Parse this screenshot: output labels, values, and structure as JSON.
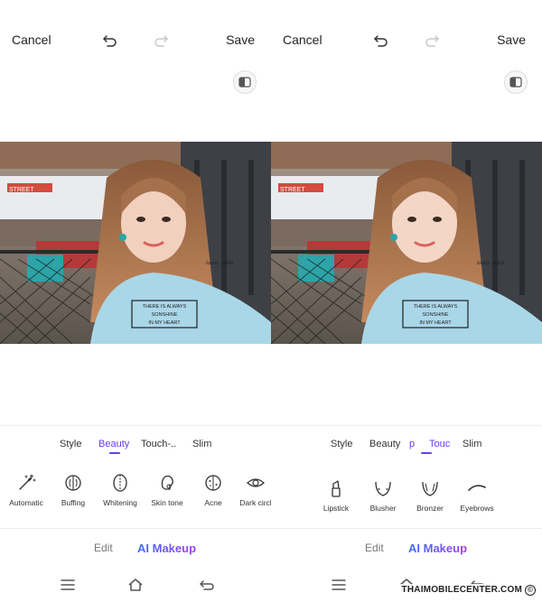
{
  "panels": [
    {
      "header": {
        "cancel": "Cancel",
        "save": "Save"
      },
      "tabs": [
        {
          "label": "Style",
          "active": false
        },
        {
          "label": "Beauty",
          "active": true
        },
        {
          "label": "Touch-..",
          "active": false
        },
        {
          "label": "Slim",
          "active": false
        }
      ],
      "tools": [
        {
          "label": "Automatic",
          "icon": "magic-wand-icon"
        },
        {
          "label": "Buffing",
          "icon": "buffing-icon"
        },
        {
          "label": "Whitening",
          "icon": "whitening-icon"
        },
        {
          "label": "Skin tone",
          "icon": "skin-tone-icon"
        },
        {
          "label": "Acne",
          "icon": "acne-icon"
        },
        {
          "label": "Dark circl",
          "icon": "eye-icon"
        }
      ],
      "modes": {
        "edit": "Edit",
        "ai": "AI Makeup"
      }
    },
    {
      "header": {
        "cancel": "Cancel",
        "save": "Save"
      },
      "tabs": [
        {
          "label": "Style",
          "active": false
        },
        {
          "label": "Beauty",
          "active": false
        },
        {
          "label": "p",
          "active": false
        },
        {
          "label": "Touc",
          "active": true
        },
        {
          "label": "Slim",
          "active": false
        }
      ],
      "tools": [
        {
          "label": "Lipstick",
          "icon": "lipstick-icon"
        },
        {
          "label": "Blusher",
          "icon": "blusher-icon"
        },
        {
          "label": "Bronzer",
          "icon": "bronzer-icon"
        },
        {
          "label": "Eyebrows",
          "icon": "eyebrow-icon"
        }
      ],
      "modes": {
        "edit": "Edit",
        "ai": "AI Makeup"
      }
    }
  ],
  "photo": {
    "shirt_text": [
      "THERE IS ALWAYS",
      "SONSHINE",
      "IN MY HEART"
    ],
    "sign_text": "STREET",
    "sleeve_text": "lovely Jlobik"
  },
  "watermark": {
    "text": "THAIMOBILECENTER.COM",
    "symbol": "©"
  },
  "colors": {
    "accent": "#6a3df0",
    "gradient_start": "#3b6ef0",
    "gradient_end": "#a13df0"
  }
}
